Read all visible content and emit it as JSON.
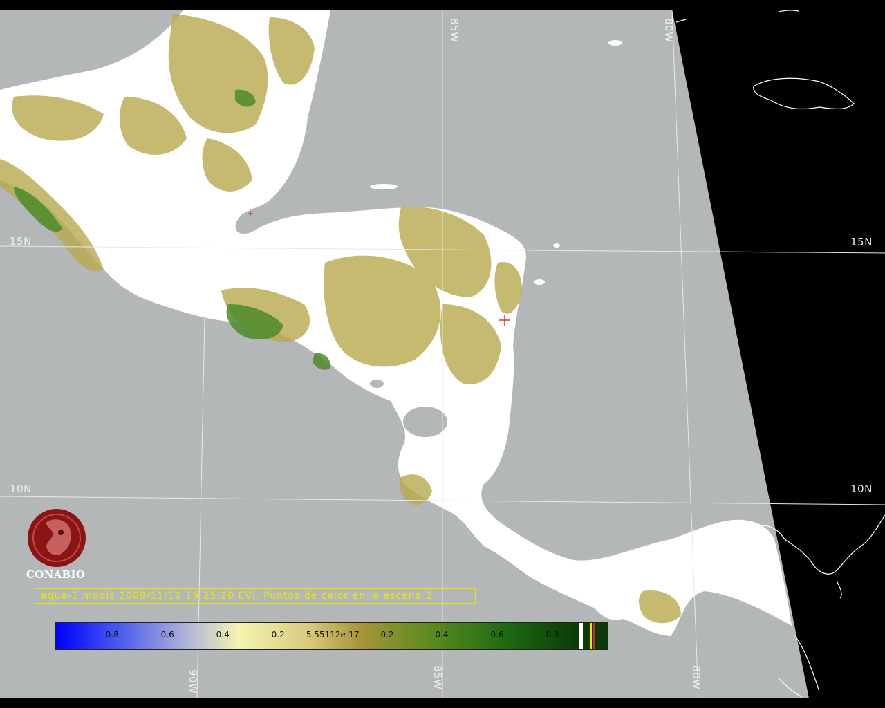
{
  "graticule": {
    "lon_labels": [
      "85W",
      "80W",
      "90W",
      "85W",
      "80W"
    ],
    "lat_labels": [
      "15N",
      "15N",
      "10N",
      "10N"
    ]
  },
  "logo": {
    "name": "CONABIO"
  },
  "caption": "aqua-1 modis 2009/11/10 19:25:20 EVI, Puntos de calor en la escena 2",
  "colorbar": {
    "ticks": [
      "-0.8",
      "-0.6",
      "-0.4",
      "-0.2",
      "-5.55112e-17",
      "0.2",
      "0.4",
      "0.6",
      "0.8"
    ],
    "range": [
      -1,
      1
    ]
  },
  "colors": {
    "ocean": "#b3b7b8",
    "no_data": "#000000",
    "land_cloud": "#ffffff",
    "caption": "#e8e800",
    "hotspot": "#e02020",
    "logo": "#8b1414"
  }
}
